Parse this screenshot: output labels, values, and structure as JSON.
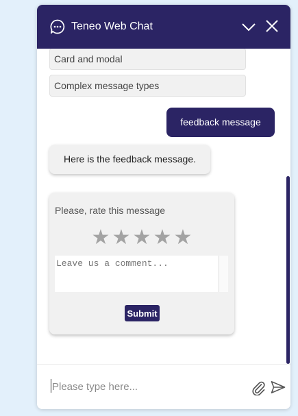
{
  "header": {
    "title": "Teneo Web Chat",
    "icons": [
      "chat-bubble-icon",
      "chevron-down-icon",
      "close-icon"
    ]
  },
  "messages": {
    "quick_replies": [
      "Card and modal",
      "Complex message types"
    ],
    "user_message": "feedback message",
    "bot_message": "Here is the feedback message."
  },
  "feedback": {
    "prompt": "Please, rate this message",
    "star_count": 5,
    "star_glyph": "★",
    "comment_placeholder": "Leave us a comment...",
    "submit_label": "Submit"
  },
  "input": {
    "placeholder": "Please type here...",
    "icons": [
      "paperclip-icon",
      "send-icon"
    ]
  },
  "colors": {
    "brand": "#2b2464",
    "background": "#e3f0fb",
    "bubble": "#f1f1f1",
    "star": "#a3a3a3"
  }
}
